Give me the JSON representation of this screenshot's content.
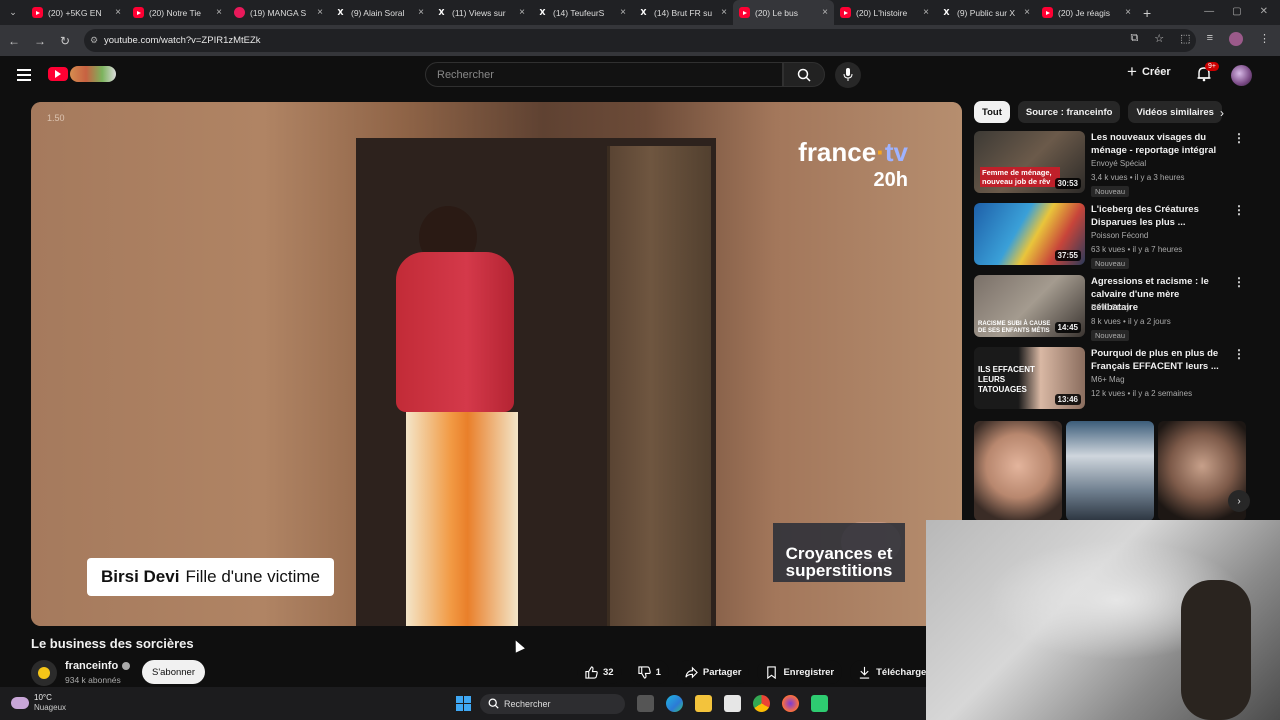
{
  "browser": {
    "tabs": [
      {
        "icon": "youtube",
        "title": "(20) +5KG EN"
      },
      {
        "icon": "youtube",
        "title": "(20) Notre Tie"
      },
      {
        "icon": "manga",
        "title": "(19) MANGA S"
      },
      {
        "icon": "x",
        "title": "(9) Alain Soral"
      },
      {
        "icon": "x",
        "title": "(11) Views sur"
      },
      {
        "icon": "x",
        "title": "(14) TeufeurS"
      },
      {
        "icon": "x",
        "title": "(14) Brut FR su"
      },
      {
        "icon": "youtube",
        "title": "(20) Le bus"
      },
      {
        "icon": "youtube",
        "title": "(20) L'histoire"
      },
      {
        "icon": "x",
        "title": "(9) Public sur X"
      },
      {
        "icon": "youtube",
        "title": "(20) Je réagis"
      }
    ],
    "url": "youtube.com/watch?v=ZPIR1zMtEZk"
  },
  "youtube": {
    "search_placeholder": "Rechercher",
    "create_label": "Créer",
    "notif_badge": "9+"
  },
  "video": {
    "speed": "1.50",
    "watermark_line1_a": "france",
    "watermark_dot": "·",
    "watermark_line1_b": "tv",
    "watermark_line2": "20h",
    "lower_third_name": "Birsi Devi",
    "lower_third_role": "Fille d'une victime",
    "caption": "Croyances et superstitions",
    "title": "Le business des sorcières",
    "channel": "franceinfo",
    "subscribers": "934 k abonnés",
    "subscribe_label": "S'abonner",
    "likes": "32",
    "dislikes": "1",
    "share_label": "Partager",
    "save_label": "Enregistrer",
    "download_label": "Télécharger"
  },
  "sidebar": {
    "chips": [
      "Tout",
      "Source : franceinfo",
      "Vidéos similaires"
    ],
    "items": [
      {
        "title": "Les nouveaux visages du ménage - reportage intégral",
        "channel": "Envoyé Spécial",
        "meta": "3,4 k vues • il y a 3 heures",
        "badge": "Nouveau",
        "duration": "30:53",
        "thumb_text": "Femme de ménage, nouveau job de rêv"
      },
      {
        "title": "L'iceberg des Créatures Disparues les plus ...",
        "channel": "Poisson Fécond",
        "meta": "63 k vues • il y a 7 heures",
        "badge": "Nouveau",
        "duration": "37:55",
        "thumb_text": ""
      },
      {
        "title": "Agressions et racisme : le calvaire d'une mère célibataire",
        "channel": "RMC Story",
        "meta": "8 k vues • il y a 2 jours",
        "badge": "Nouveau",
        "duration": "14:45",
        "thumb_text": "RACISME SUBI À CAUSE DE SES ENFANTS MÉTIS"
      },
      {
        "title": "Pourquoi de plus en plus de Français EFFACENT leurs ...",
        "channel": "M6+ Mag",
        "meta": "12 k vues • il y a 2 semaines",
        "badge": "",
        "duration": "13:46",
        "thumb_text": "ILS EFFACENT LEURS TATOUAGES"
      }
    ]
  },
  "taskbar": {
    "temperature": "10°C",
    "weather": "Nuageux",
    "search": "Rechercher"
  }
}
